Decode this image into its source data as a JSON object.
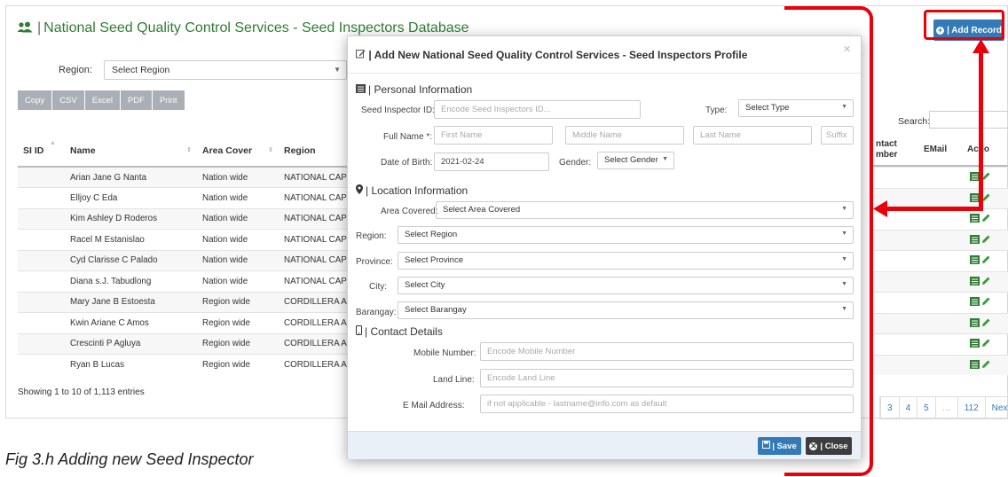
{
  "app": {
    "title": "National Seed Quality Control Services - Seed Inspectors Database",
    "add_record_label": "| Add Record",
    "region_label": "Region:",
    "region_select": "Select Region",
    "export_buttons": [
      "Copy",
      "CSV",
      "Excel",
      "PDF",
      "Print"
    ],
    "search_label": "Search:",
    "columns": [
      "SI ID",
      "Name",
      "Area Cover",
      "Region"
    ],
    "right_columns": {
      "contact_line1": "ntact",
      "contact_line2": "mber",
      "email": "EMail",
      "action": "Actio"
    },
    "rows": [
      {
        "name": "Arian Jane G Nanta",
        "area": "Nation wide",
        "region": "NATIONAL CAPITA"
      },
      {
        "name": "Elljoy C Eda",
        "area": "Nation wide",
        "region": "NATIONAL CAPITA"
      },
      {
        "name": "Kim Ashley D Roderos",
        "area": "Nation wide",
        "region": "NATIONAL CAPITA"
      },
      {
        "name": "Racel M Estanislao",
        "area": "Nation wide",
        "region": "NATIONAL CAPITA"
      },
      {
        "name": "Cyd Clarisse C Palado",
        "area": "Nation wide",
        "region": "NATIONAL CAPITA"
      },
      {
        "name": "Diana s.J. Tabudlong",
        "area": "Nation wide",
        "region": "NATIONAL CAPITA"
      },
      {
        "name": "Mary Jane B Estoesta",
        "area": "Region wide",
        "region": "CORDILLERA ADM"
      },
      {
        "name": "Kwin Ariane C Amos",
        "area": "Region wide",
        "region": "CORDILLERA ADM"
      },
      {
        "name": "Crescinti P Agluya",
        "area": "Region wide",
        "region": "CORDILLERA ADM"
      },
      {
        "name": "Ryan B Lucas",
        "area": "Region wide",
        "region": "CORDILLERA ADM"
      }
    ],
    "showing_text": "Showing 1 to 10 of 1,113 entries",
    "pager": [
      "3",
      "4",
      "5",
      "…",
      "112",
      "Next"
    ]
  },
  "caption": "Fig 3.h Adding new Seed Inspector",
  "modal": {
    "title": "| Add New National Seed Quality Control Services - Seed Inspectors Profile",
    "close_symbol": "×",
    "personal": {
      "section": "| Personal Information",
      "id_label": "Seed Inspector ID:",
      "id_placeholder": "Encode Seed Inspectors ID...",
      "type_label": "Type:",
      "type_select": "Select Type",
      "fullname_label": "Full Name *:",
      "first_placeholder": "First Name",
      "middle_placeholder": "Middle Name",
      "last_placeholder": "Last Name",
      "suffix_placeholder": "Suffix",
      "dob_label": "Date of Birth:",
      "dob_value": "2021-02-24",
      "gender_label": "Gender:",
      "gender_select": "Select Gender"
    },
    "location": {
      "section": "| Location Information",
      "area_label": "Area Covered:",
      "area_select": "Select Area Covered",
      "region_label": "Region:",
      "region_select": "Select Region",
      "province_label": "Province:",
      "province_select": "Select Province",
      "city_label": "City:",
      "city_select": "Select City",
      "barangay_label": "Barangay:",
      "barangay_select": "Select Barangay"
    },
    "contact": {
      "section": "| Contact Details",
      "mobile_label": "Mobile Number:",
      "mobile_placeholder": "Encode Mobile Number",
      "landline_label": "Land Line:",
      "landline_placeholder": "Encode Land Line",
      "email_label": "E Mail Address:",
      "email_placeholder": "if not applicable - lastname@info.com as default"
    },
    "save_label": "| Save",
    "close_label": "| Close"
  },
  "colors": {
    "accent": "#337ab7",
    "title_green": "#2e7d32",
    "annotation_red": "#e8000b",
    "close_dark": "#3d3d3d"
  }
}
